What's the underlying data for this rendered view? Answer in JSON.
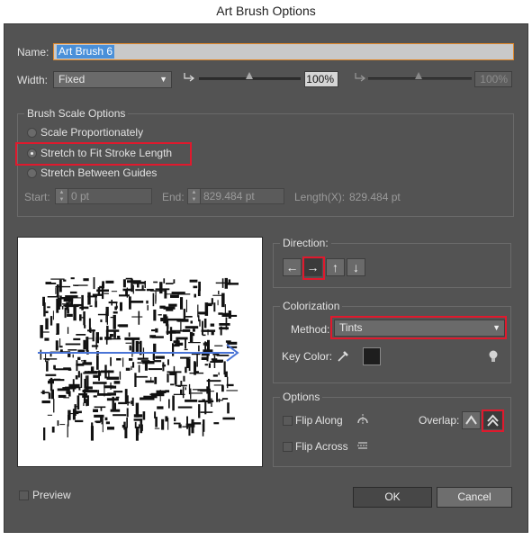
{
  "window": {
    "title": "Art Brush Options"
  },
  "name": {
    "label": "Name:",
    "value": "Art Brush 6"
  },
  "width": {
    "label": "Width:",
    "selected": "Fixed",
    "value1": "100%",
    "value2": "100%"
  },
  "brush_scale": {
    "legend": "Brush Scale Options",
    "options": [
      {
        "label": "Scale Proportionately",
        "selected": false
      },
      {
        "label": "Stretch to Fit Stroke Length",
        "selected": true
      },
      {
        "label": "Stretch Between Guides",
        "selected": false
      }
    ],
    "start_label": "Start:",
    "start_value": "0 pt",
    "end_label": "End:",
    "end_value": "829.484 pt",
    "length_label": "Length(X):",
    "length_value": "829.484 pt"
  },
  "direction": {
    "legend": "Direction:",
    "buttons": [
      {
        "icon": "arrow-left-icon",
        "glyph": "←"
      },
      {
        "icon": "arrow-right-icon",
        "glyph": "→"
      },
      {
        "icon": "arrow-up-icon",
        "glyph": "↑"
      },
      {
        "icon": "arrow-down-icon",
        "glyph": "↓"
      }
    ],
    "selected_index": 1
  },
  "colorization": {
    "legend": "Colorization",
    "method_label": "Method:",
    "method_value": "Tints",
    "key_color_label": "Key Color:",
    "key_color": "#1e1e1e"
  },
  "options": {
    "legend": "Options",
    "flip_along": "Flip Along",
    "flip_across": "Flip Across",
    "overlap_label": "Overlap:"
  },
  "footer": {
    "preview_label": "Preview",
    "ok_label": "OK",
    "cancel_label": "Cancel"
  },
  "colors": {
    "dialog_bg": "#535353",
    "highlight_red": "#e0192d",
    "selection_blue": "#4a90d9",
    "preview_arrow": "#4a74d6"
  }
}
